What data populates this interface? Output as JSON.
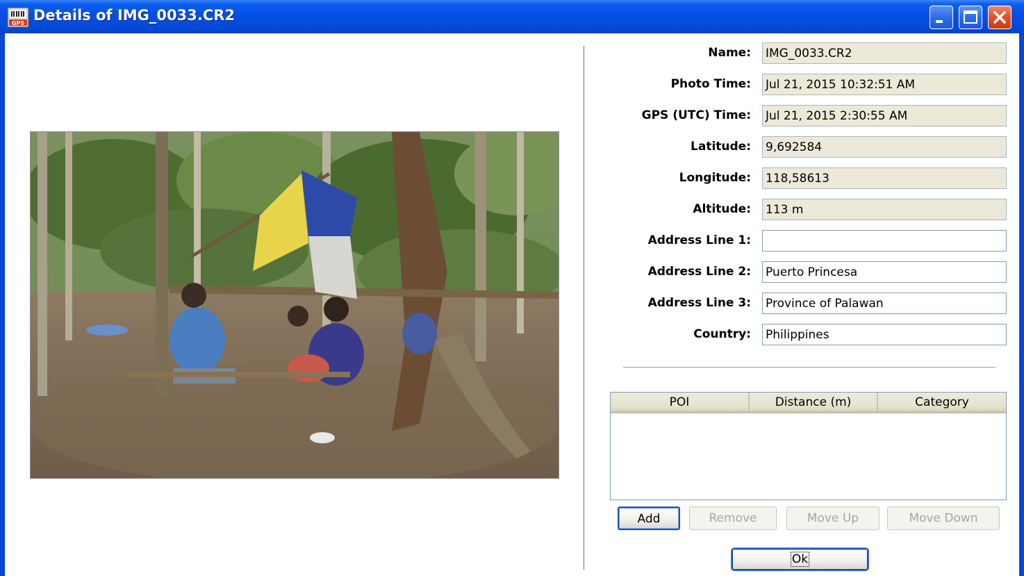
{
  "window": {
    "title": "Details of IMG_0033.CR2",
    "icon": "gps-app-icon",
    "controls": [
      "minimize",
      "maximize",
      "close"
    ]
  },
  "photo": {
    "description": "",
    "icon": "photo-image"
  },
  "fields": [
    {
      "label": "Name:",
      "value": "IMG_0033.CR2",
      "editable": false
    },
    {
      "label": "Photo Time:",
      "value": "Jul 21, 2015 10:32:51 AM",
      "editable": false
    },
    {
      "label": "GPS (UTC) Time:",
      "value": "Jul 21, 2015 2:30:55 AM",
      "editable": false
    },
    {
      "label": "Latitude:",
      "value": "9,692584",
      "editable": false
    },
    {
      "label": "Longitude:",
      "value": "118,58613",
      "editable": false
    },
    {
      "label": "Altitude:",
      "value": "113 m",
      "editable": false
    },
    {
      "label": "Address Line 1:",
      "value": "",
      "editable": true
    },
    {
      "label": "Address Line 2:",
      "value": "Puerto Princesa",
      "editable": true
    },
    {
      "label": "Address Line 3:",
      "value": "Province of Palawan",
      "editable": true
    },
    {
      "label": "Country:",
      "value": "Philippines",
      "editable": true
    }
  ],
  "poi_table": {
    "columns": [
      "POI",
      "Distance (m)",
      "Category"
    ],
    "rows": []
  },
  "buttons": {
    "add": "Add",
    "remove": "Remove",
    "move_up": "Move Up",
    "move_down": "Move Down",
    "ok": "Ok"
  },
  "colors": {
    "titlebar": "#0650e6",
    "readonly_field": "#ece9d8",
    "disabled_text": "#a8a79b"
  }
}
